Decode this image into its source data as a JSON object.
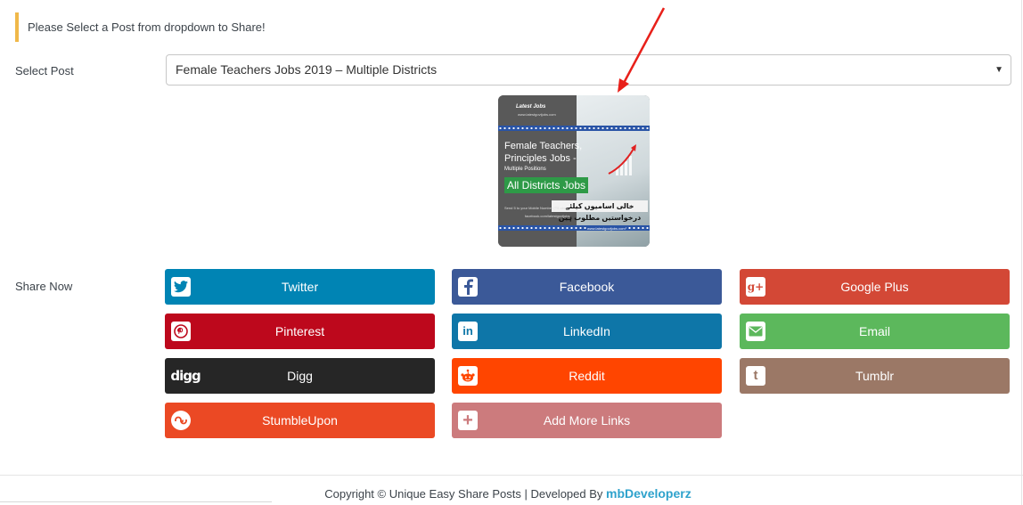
{
  "notice": {
    "text": "Please Select a Post from dropdown to Share!",
    "accent": "#f0b849"
  },
  "select_post": {
    "label": "Select Post",
    "selected": "Female Teachers Jobs 2019 – Multiple Districts"
  },
  "thumbnail": {
    "brand": "Latest        Jobs",
    "headline_line1": "Female Teachers,",
    "headline_line2": "Principles Jobs -",
    "sub": "Multiple Positions",
    "banner": "All Districts Jobs",
    "urdu": "خالی اسامیوں کیلئے درخواستیں مطلوب ہیں",
    "small_line": "Send 5 to your Mobile Number (T5 abcs)",
    "facebook": "facebook.com/latestgovtjobs",
    "site": "www.latestgovtjobs.com"
  },
  "share": {
    "label": "Share Now",
    "buttons": [
      {
        "label": "Twitter",
        "color": "#0084b4",
        "icon": "twitter-icon"
      },
      {
        "label": "Facebook",
        "color": "#3b5998",
        "icon": "facebook-icon"
      },
      {
        "label": "Google Plus",
        "color": "#d34836",
        "icon": "google-plus-icon"
      },
      {
        "label": "Pinterest",
        "color": "#bd081c",
        "icon": "pinterest-icon"
      },
      {
        "label": "LinkedIn",
        "color": "#0e76a8",
        "icon": "linkedin-icon"
      },
      {
        "label": "Email",
        "color": "#5cb85c",
        "icon": "email-icon"
      },
      {
        "label": "Digg",
        "color": "#262626",
        "icon": "digg-icon"
      },
      {
        "label": "Reddit",
        "color": "#ff4500",
        "icon": "reddit-icon"
      },
      {
        "label": "Tumblr",
        "color": "#9b7866",
        "icon": "tumblr-icon"
      },
      {
        "label": "StumbleUpon",
        "color": "#eb4924",
        "icon": "stumbleupon-icon"
      },
      {
        "label": "Add More Links",
        "color": "#cc7b7d",
        "icon": "plus-icon"
      }
    ]
  },
  "footer": {
    "text": "Copyright © Unique Easy Share Posts | Developed By ",
    "brand": "mbDeveloperz"
  }
}
